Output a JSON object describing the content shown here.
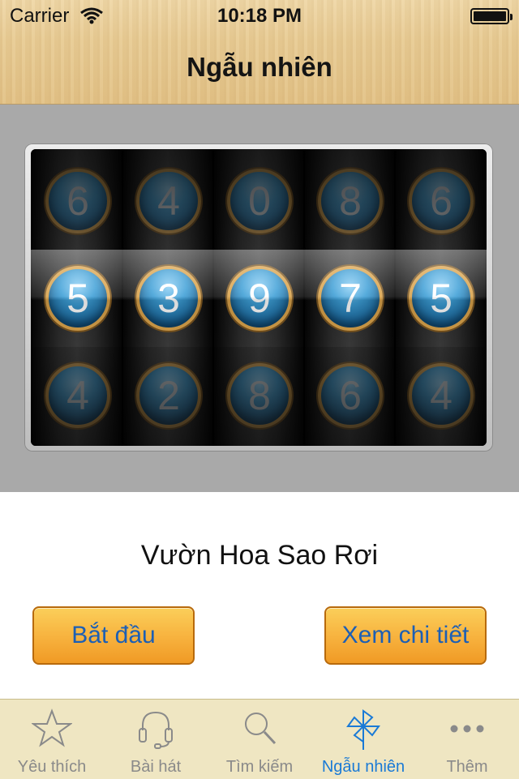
{
  "status_bar": {
    "carrier": "Carrier",
    "time": "10:18 PM"
  },
  "header": {
    "title": "Ngẫu nhiên"
  },
  "slot_machine": {
    "reels": [
      {
        "top": "6",
        "middle": "5",
        "bottom": "4"
      },
      {
        "top": "4",
        "middle": "3",
        "bottom": "2"
      },
      {
        "top": "0",
        "middle": "9",
        "bottom": "8"
      },
      {
        "top": "8",
        "middle": "7",
        "bottom": "6"
      },
      {
        "top": "6",
        "middle": "5",
        "bottom": "4"
      }
    ]
  },
  "result": {
    "song_title": "Vườn Hoa Sao Rơi"
  },
  "buttons": {
    "start_label": "Bắt đầu",
    "detail_label": "Xem chi tiết"
  },
  "tabbar": {
    "items": [
      {
        "label": "Yêu thích",
        "icon": "star-icon"
      },
      {
        "label": "Bài hát",
        "icon": "headphones-icon"
      },
      {
        "label": "Tìm kiếm",
        "icon": "search-icon"
      },
      {
        "label": "Ngẫu nhiên",
        "icon": "pinwheel-icon",
        "active": true
      },
      {
        "label": "Thêm",
        "icon": "more-icon"
      }
    ]
  },
  "colors": {
    "accent": "#1a7ad6",
    "button_orange": "#f7b13d",
    "button_text": "#1c5fb5",
    "tabbar_bg": "#efe6c2"
  }
}
